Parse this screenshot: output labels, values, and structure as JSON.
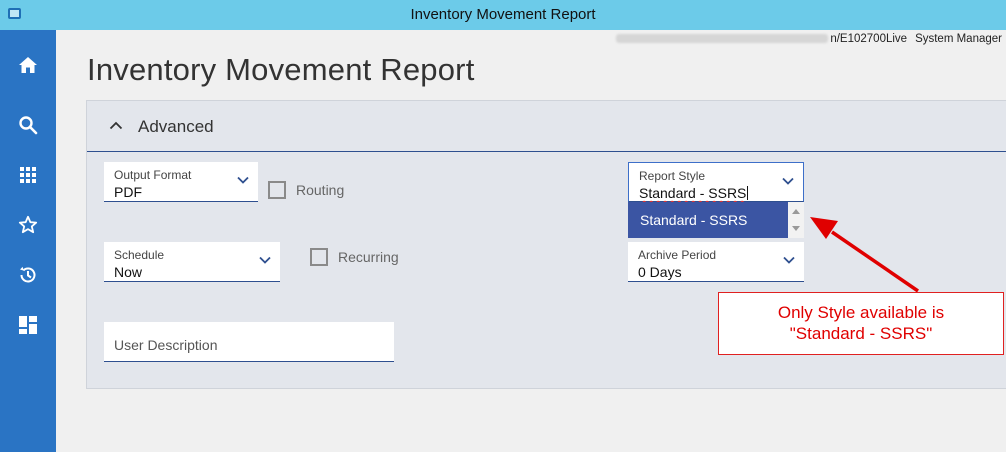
{
  "window": {
    "title": "Inventory Movement Report"
  },
  "header": {
    "connection": "n/E102700Live",
    "user": "System Manager"
  },
  "sidebar": {
    "items": [
      {
        "icon": "home-icon"
      },
      {
        "icon": "search-icon"
      },
      {
        "icon": "apps-grid-icon"
      },
      {
        "icon": "star-icon"
      },
      {
        "icon": "history-icon"
      },
      {
        "icon": "dashboard-icon"
      }
    ]
  },
  "page": {
    "title": "Inventory Movement Report"
  },
  "panel": {
    "title": "Advanced"
  },
  "fields": {
    "output_format": {
      "label": "Output Format",
      "value": "PDF"
    },
    "routing": {
      "label": "Routing",
      "checked": false
    },
    "schedule": {
      "label": "Schedule",
      "value": "Now"
    },
    "recurring": {
      "label": "Recurring",
      "checked": false
    },
    "user_description": {
      "placeholder": "User Description"
    },
    "report_style": {
      "label": "Report Style",
      "value": "Standard - SSRS",
      "options": [
        "Standard - SSRS"
      ]
    },
    "archive_period": {
      "label": "Archive Period",
      "value": "0 Days"
    }
  },
  "annotation": {
    "line1": "Only Style available is",
    "line2": "\"Standard - SSRS\""
  },
  "colors": {
    "accent": "#2a74c4",
    "titlebar": "#6ccbe9",
    "selected_option": "#3b55a3",
    "annotation": "#e00000"
  }
}
